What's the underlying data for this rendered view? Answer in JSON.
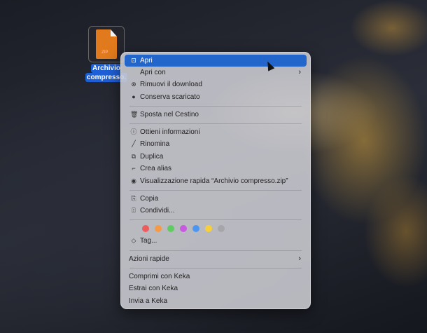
{
  "file": {
    "name_line1": "Archivio",
    "name_line2": "compresso.",
    "badge": "ZIP"
  },
  "menu": {
    "open": "Apri",
    "open_with": "Apri con",
    "remove_download": "Rimuovi il download",
    "keep_downloaded": "Conserva scaricato",
    "move_trash": "Sposta nel Cestino",
    "get_info": "Ottieni informazioni",
    "rename": "Rinomina",
    "duplicate": "Duplica",
    "make_alias": "Crea alias",
    "quick_look": "Visualizzazione rapida “Archivio compresso.zip”",
    "copy": "Copia",
    "share": "Condividi...",
    "tag_colors": [
      "#ee5b5b",
      "#f59a45",
      "#5fcc62",
      "#c85ae0",
      "#4a96f0",
      "#f5d03a",
      "#a5a5aa"
    ],
    "tags": "Tag...",
    "quick_actions": "Azioni rapide",
    "compress_keka": "Comprimi con Keka",
    "extract_keka": "Estrai con Keka",
    "send_keka": "Invia a Keka"
  }
}
